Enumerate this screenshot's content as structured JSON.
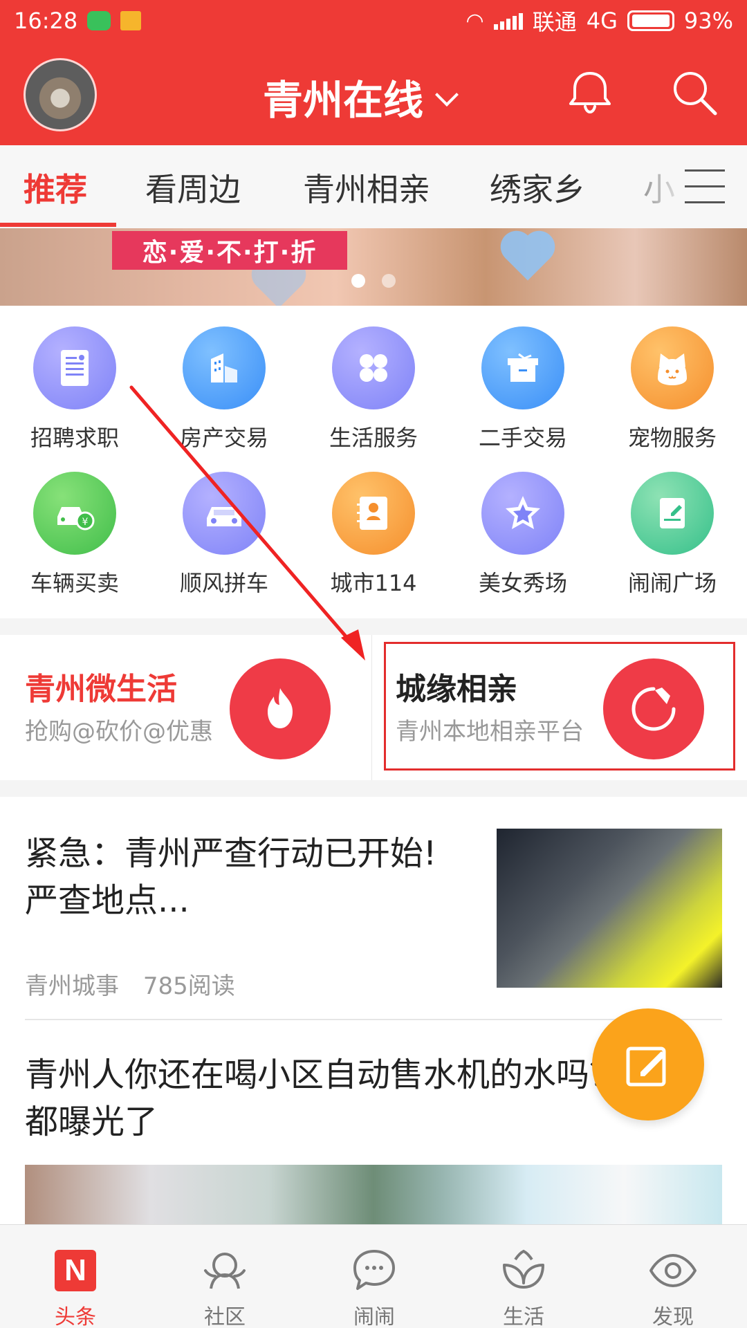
{
  "status_bar": {
    "time": "16:28",
    "carrier": "联通",
    "network": "4G",
    "battery": "93%"
  },
  "header": {
    "title": "青州在线"
  },
  "tabs": [
    "推荐",
    "看周边",
    "青州相亲",
    "绣家乡",
    "小"
  ],
  "banner": {
    "slogan": "恋·爱·不·打·折",
    "active_dot": 1,
    "dot_count": 2
  },
  "services": [
    {
      "label": "招聘求职",
      "icon": "resume-icon"
    },
    {
      "label": "房产交易",
      "icon": "buildings-icon"
    },
    {
      "label": "生活服务",
      "icon": "grid-icon"
    },
    {
      "label": "二手交易",
      "icon": "box-icon"
    },
    {
      "label": "宠物服务",
      "icon": "cat-icon"
    },
    {
      "label": "车辆买卖",
      "icon": "car-yen-icon"
    },
    {
      "label": "顺风拼车",
      "icon": "car-icon"
    },
    {
      "label": "城市114",
      "icon": "contact-card-icon"
    },
    {
      "label": "美女秀场",
      "icon": "star-icon"
    },
    {
      "label": "闹闹广场",
      "icon": "note-edit-icon"
    }
  ],
  "promos": {
    "left": {
      "title": "青州微生活",
      "subtitle": "抢购@砍价@优惠",
      "icon": "flame-icon"
    },
    "right": {
      "title": "城缘相亲",
      "subtitle": "青州本地相亲平台",
      "icon": "refresh-tag-icon"
    }
  },
  "news": [
    {
      "title_line1": "紧急：青州严查行动已开始!",
      "title_line2": "严查地点...",
      "source": "青州城事",
      "reads": "785阅读"
    },
    {
      "title_line1": "青州人你还在喝小区自动售水机的水吗？实现",
      "title_line2": "都曝光了"
    }
  ],
  "bottom_nav": [
    {
      "label": "头条",
      "active": true,
      "icon": "news-n-icon"
    },
    {
      "label": "社区",
      "active": false,
      "icon": "community-icon"
    },
    {
      "label": "闹闹",
      "active": false,
      "icon": "chat-bubble-icon"
    },
    {
      "label": "生活",
      "active": false,
      "icon": "lotus-icon"
    },
    {
      "label": "发现",
      "active": false,
      "icon": "eye-icon"
    }
  ],
  "colors": {
    "brand": "#ee3a36",
    "promo_red": "#ef3b47",
    "fab": "#fba31b"
  }
}
